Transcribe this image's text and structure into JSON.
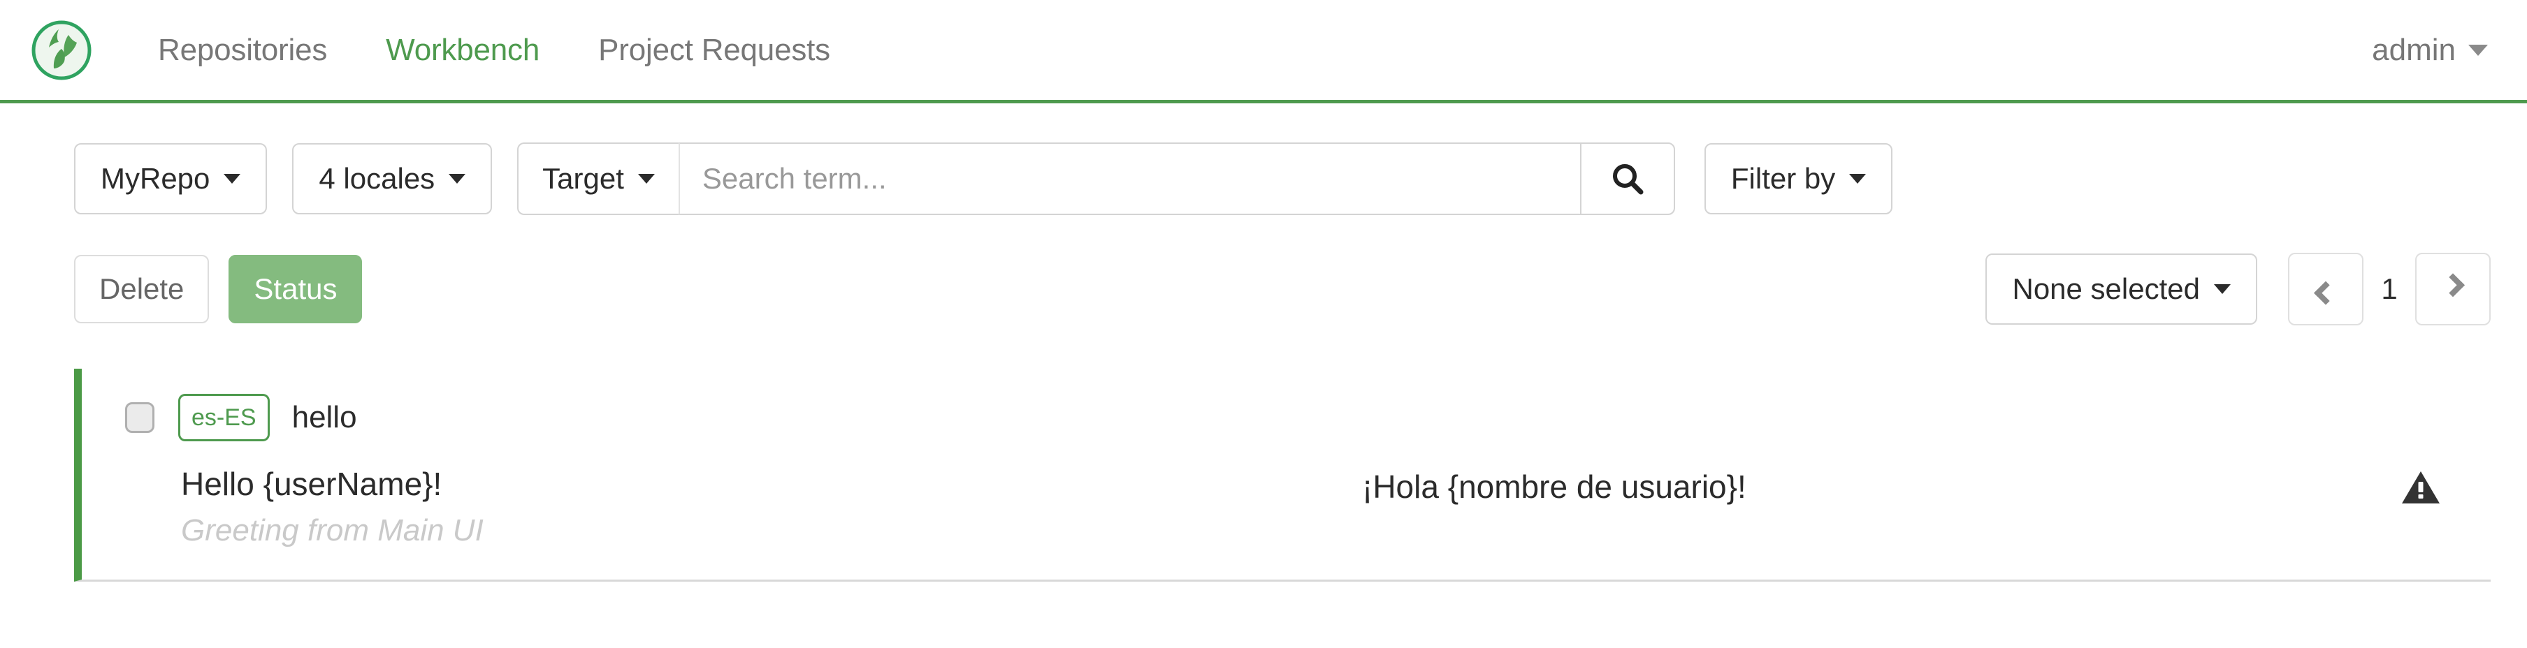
{
  "brand": {
    "logo_icon": "globe-leaf-logo",
    "accent_color": "#4e9a4e"
  },
  "navbar": {
    "links": [
      {
        "label": "Repositories",
        "active": false
      },
      {
        "label": "Workbench",
        "active": true
      },
      {
        "label": "Project Requests",
        "active": false
      }
    ],
    "user": {
      "name": "admin",
      "caret_icon": "chevron-down-icon"
    }
  },
  "toolbar": {
    "repo_selector": {
      "label": "MyRepo",
      "caret_icon": "chevron-down-icon"
    },
    "locales_selector": {
      "label": "4 locales",
      "caret_icon": "chevron-down-icon"
    },
    "scope_selector": {
      "label": "Target",
      "caret_icon": "chevron-down-icon"
    },
    "search": {
      "value": "",
      "placeholder": "Search term..."
    },
    "search_button": {
      "icon": "search-icon",
      "label": ""
    },
    "filter_button": {
      "label": "Filter by",
      "caret_icon": "chevron-down-icon"
    }
  },
  "actionbar": {
    "delete_label": "Delete",
    "status_label": "Status",
    "status_color": "#84bb7f",
    "selection_dropdown": {
      "label": "None selected",
      "caret_icon": "chevron-down-icon"
    },
    "pagination": {
      "prev_icon": "chevron-left-icon",
      "page": "1",
      "next_icon": "chevron-right-icon"
    }
  },
  "results": {
    "rows": [
      {
        "accent_color": "#4b9a46",
        "checked": false,
        "locale": "es-ES",
        "key": "hello",
        "source_text": "Hello {userName}!",
        "source_note": "Greeting from Main UI",
        "target_text": "¡Hola {nombre de usuario}!",
        "flag_icon": "warning-triangle-icon"
      }
    ]
  }
}
